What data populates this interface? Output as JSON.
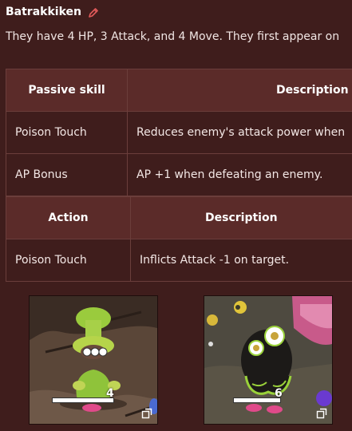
{
  "heading": {
    "name": "Batrakkiken",
    "edit_icon": "pencil-icon"
  },
  "intro_text": "They have 4 HP, 3 Attack, and 4 Move. They first appear on",
  "passive_table": {
    "headers": [
      "Passive skill",
      "Description"
    ],
    "rows": [
      [
        "Poison Touch",
        "Reduces enemy's attack power when"
      ],
      [
        "AP Bonus",
        "AP +1 when defeating an enemy."
      ]
    ]
  },
  "action_table": {
    "headers": [
      "Action",
      "Description"
    ],
    "rows": [
      [
        "Poison Touch",
        "Inflicts Attack -1 on target."
      ]
    ]
  },
  "screenshots": [
    {
      "hp_value": "4",
      "expand_icon": "expand-icon"
    },
    {
      "hp_value": "6",
      "expand_icon": "expand-icon"
    }
  ],
  "colors": {
    "background": "#3f1d1c",
    "header_background": "#5b2b29",
    "border": "#6b3e3b",
    "edit_icon": "#e05a5a"
  }
}
